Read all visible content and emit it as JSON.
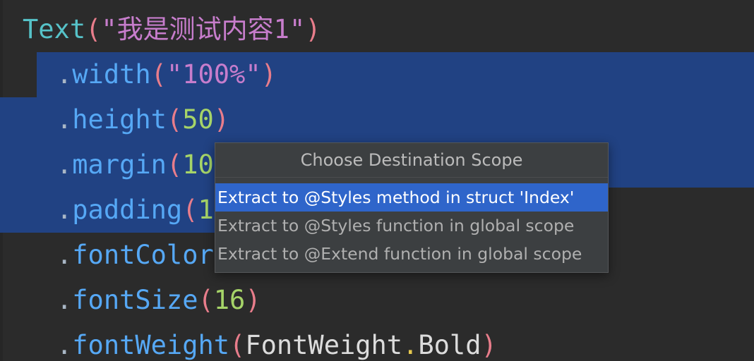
{
  "code": {
    "line0": {
      "component": "Text",
      "open": "(",
      "string": "\"我是测试内容1\"",
      "close": ")"
    },
    "line1": {
      "dot": ".",
      "method": "width",
      "open": "(",
      "string": "\"100%\"",
      "close": ")"
    },
    "line2": {
      "dot": ".",
      "method": "height",
      "open": "(",
      "number": "50",
      "close": ")"
    },
    "line3": {
      "dot": ".",
      "method": "margin",
      "open": "(",
      "number": "10"
    },
    "line4": {
      "dot": ".",
      "method": "padding",
      "open": "(",
      "number": "1"
    },
    "line5": {
      "dot": ".",
      "method": "fontColor"
    },
    "line6": {
      "dot": ".",
      "method": "fontSize",
      "open": "(",
      "number": "16",
      "close": ")"
    },
    "line7": {
      "dot": ".",
      "method": "fontWeight",
      "open": "(",
      "enum_type": "FontWeight",
      "enum_dot": ".",
      "enum_value": "Bold",
      "close": ")"
    }
  },
  "popup": {
    "title": "Choose Destination Scope",
    "options": [
      {
        "label": "Extract to @Styles method in struct 'Index'",
        "selected": true
      },
      {
        "label": "Extract to @Styles function in global scope",
        "selected": false
      },
      {
        "label": "Extract to @Extend function in global scope",
        "selected": false
      }
    ]
  },
  "colors": {
    "editor_background": "#2b2b2b",
    "selection": "#214283",
    "popup_background": "#3c3f41",
    "popup_selected_item": "#2f65ca"
  }
}
